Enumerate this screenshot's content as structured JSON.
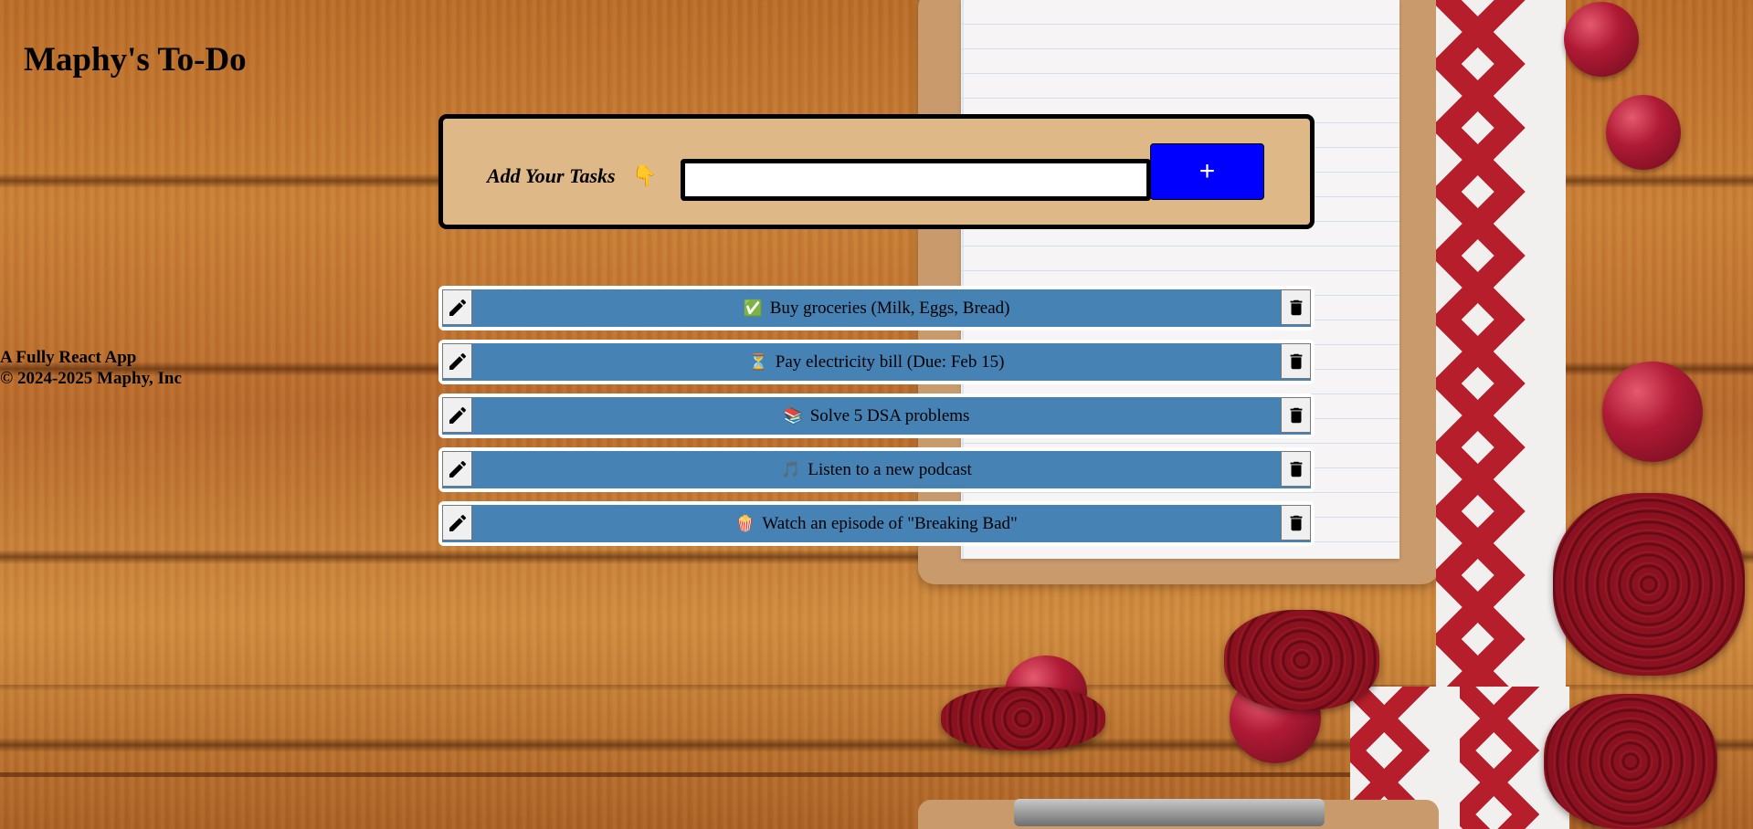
{
  "app": {
    "title": "Maphy's To-Do"
  },
  "add_panel": {
    "label": "Add Your Tasks",
    "label_icon": "point-down-hand-icon",
    "label_emoji": "👇",
    "input_value": "",
    "input_placeholder": "",
    "add_button_label": "+"
  },
  "tasks": [
    {
      "emoji": "✅",
      "icon": "check-mark-icon",
      "text": "Buy groceries (Milk, Eggs, Bread)"
    },
    {
      "emoji": "⏳",
      "icon": "hourglass-icon",
      "text": "Pay electricity bill (Due: Feb 15)"
    },
    {
      "emoji": "📚",
      "icon": "books-icon",
      "text": "Solve 5 DSA problems"
    },
    {
      "emoji": "🎵",
      "icon": "music-note-icon",
      "text": "Listen to a new podcast"
    },
    {
      "emoji": "🍿",
      "icon": "popcorn-icon",
      "text": "Watch an episode of \"Breaking Bad\""
    }
  ],
  "footer": {
    "line1": "A Fully React App",
    "line2": "© 2024-2025 Maphy, Inc"
  },
  "colors": {
    "panel_background": "#dfb887",
    "add_button": "#0000ff",
    "task_row": "#4682b4"
  }
}
